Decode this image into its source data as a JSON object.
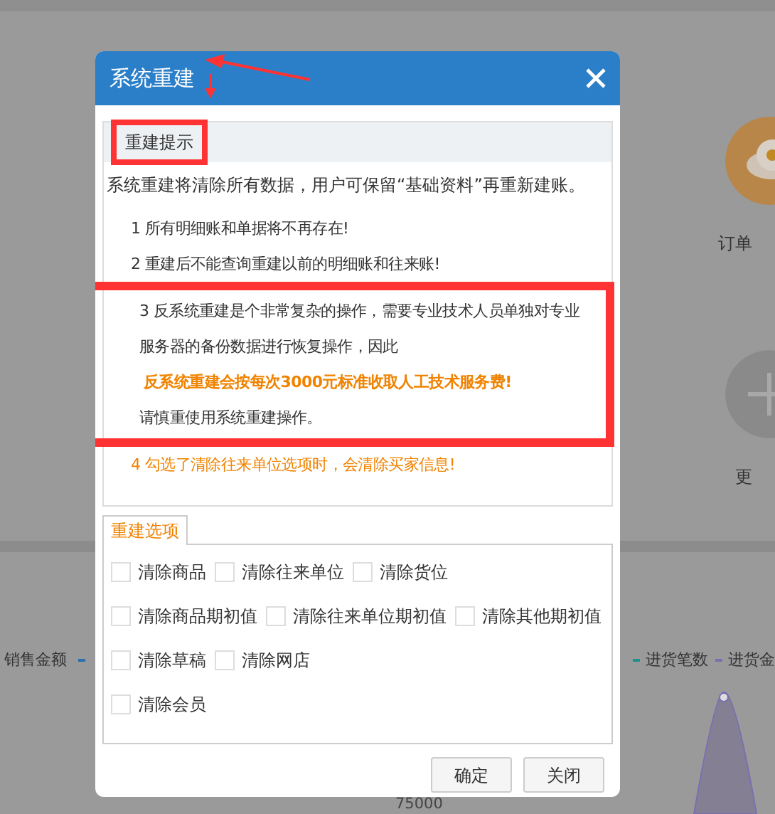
{
  "background": {
    "shortcuts": [
      {
        "label": "订单",
        "kind": "coin"
      },
      {
        "label": "更",
        "kind": "plus"
      }
    ],
    "legend": [
      {
        "label": "销售金额",
        "color": "#2b6fb0"
      },
      {
        "label": "进货笔数",
        "color": "#1f8f8a"
      },
      {
        "label": "进货金",
        "color": "#7b6fb0"
      }
    ],
    "axis_label": "75000"
  },
  "dialog": {
    "title": "系统重建",
    "notice": {
      "heading": "重建提示",
      "heading_highlighted": true,
      "intro": "系统重建将清除所有数据，用户可保留“基础资料”再重新建账。",
      "items": [
        {
          "text": "1 所有明细账和单据将不再存在!",
          "kind": "plain",
          "highlighted": false
        },
        {
          "text": "2 重建后不能查询重建以前的明细账和往来账!",
          "kind": "plain",
          "highlighted": false
        },
        {
          "text": "3 反系统重建是个非常复杂的操作，需要专业技术人员单独对专业服务器的备份数据进行恢复操作，因此",
          "kind": "plain",
          "highlighted": true
        },
        {
          "text": "反系统重建会按每次3000元标准收取人工技术服务费!",
          "kind": "fee",
          "highlighted": true
        },
        {
          "text": "请慎重使用系统重建操作。",
          "kind": "plain",
          "highlighted": true
        },
        {
          "text": "4 勾选了清除往来单位选项时，会清除买家信息!",
          "kind": "warning",
          "highlighted": false
        }
      ]
    },
    "options": {
      "tab": "重建选项",
      "rows": [
        [
          {
            "label": "清除商品",
            "checked": false
          },
          {
            "label": "清除往来单位",
            "checked": false
          },
          {
            "label": "清除货位",
            "checked": false
          }
        ],
        [
          {
            "label": "清除商品期初值",
            "checked": false
          },
          {
            "label": "清除往来单位期初值",
            "checked": false
          },
          {
            "label": "清除其他期初值",
            "checked": false
          }
        ],
        [
          {
            "label": "清除草稿",
            "checked": false
          },
          {
            "label": "清除网店",
            "checked": false
          }
        ],
        [
          {
            "label": "清除会员",
            "checked": false
          }
        ]
      ]
    },
    "buttons": [
      {
        "label": "确定"
      },
      {
        "label": "关闭"
      }
    ]
  }
}
